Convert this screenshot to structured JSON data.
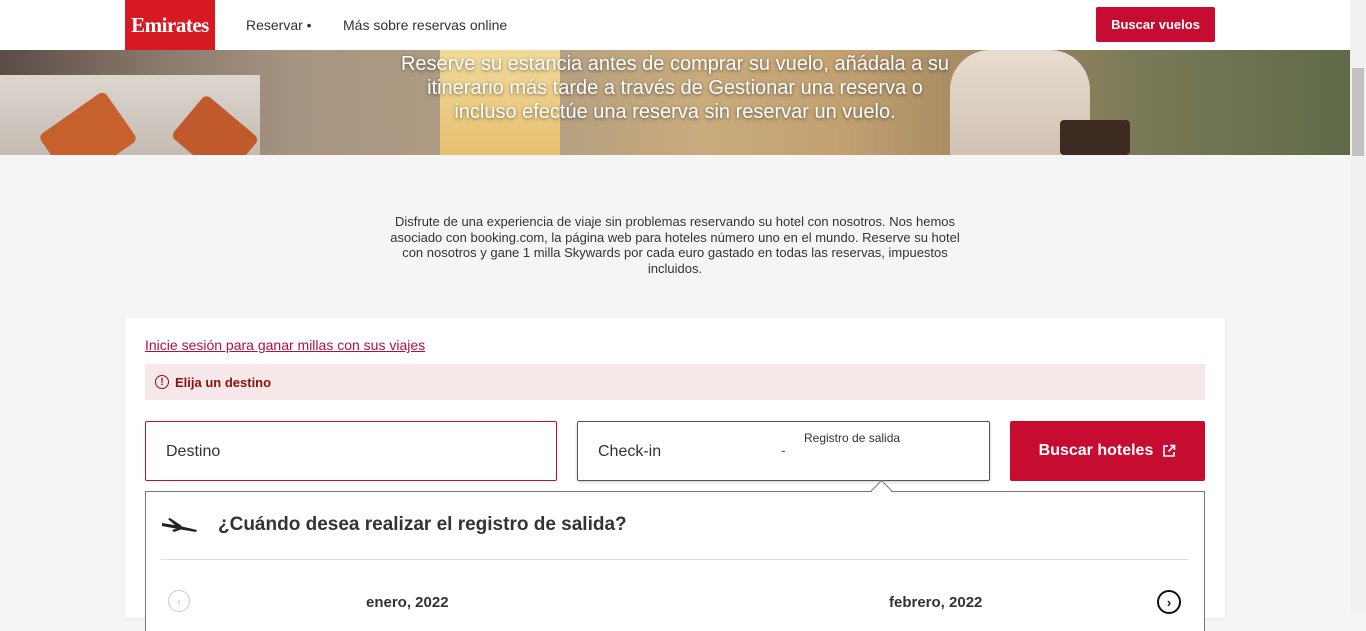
{
  "header": {
    "logo_text": "Emirates",
    "nav": [
      "Reservar •",
      "Más sobre reservas online"
    ],
    "search_flights_label": "Buscar vuelos"
  },
  "hero": {
    "text": "Reserve su estancia antes de comprar su vuelo, añádala a su itinerario más tarde a través de Gestionar una reserva o incluso efectúe una reserva sin reservar un vuelo."
  },
  "intro": {
    "text": "Disfrute de una experiencia de viaje sin problemas reservando su hotel con nosotros. Nos hemos asociado con booking.com, la página web para hoteles número uno en el mundo. Reserve su hotel con nosotros y gane 1 milla Skywards por cada euro gastado en todas las reservas, impuestos incluidos."
  },
  "search": {
    "signin_link": "Inicie sesión para ganar millas con sus viajes",
    "error_message": "Elija un destino",
    "destination_label": "Destino",
    "checkin_label": "Check-in",
    "date_separator": "-",
    "checkout_label": "Registro de salida",
    "search_button": "Buscar hoteles"
  },
  "calendar": {
    "title": "¿Cuándo desea realizar el registro de salida?",
    "months": [
      "enero, 2022",
      "febrero, 2022"
    ]
  },
  "colors": {
    "brand_red": "#c60c30",
    "logo_red": "#d71921",
    "error_text": "#8c0f14",
    "error_bg": "#f6e8e8"
  },
  "icons": {
    "alert": "exclamation-circle-icon",
    "external": "external-link-icon",
    "plane": "plane-icon",
    "prev": "chevron-left-icon",
    "next": "chevron-right-icon"
  }
}
